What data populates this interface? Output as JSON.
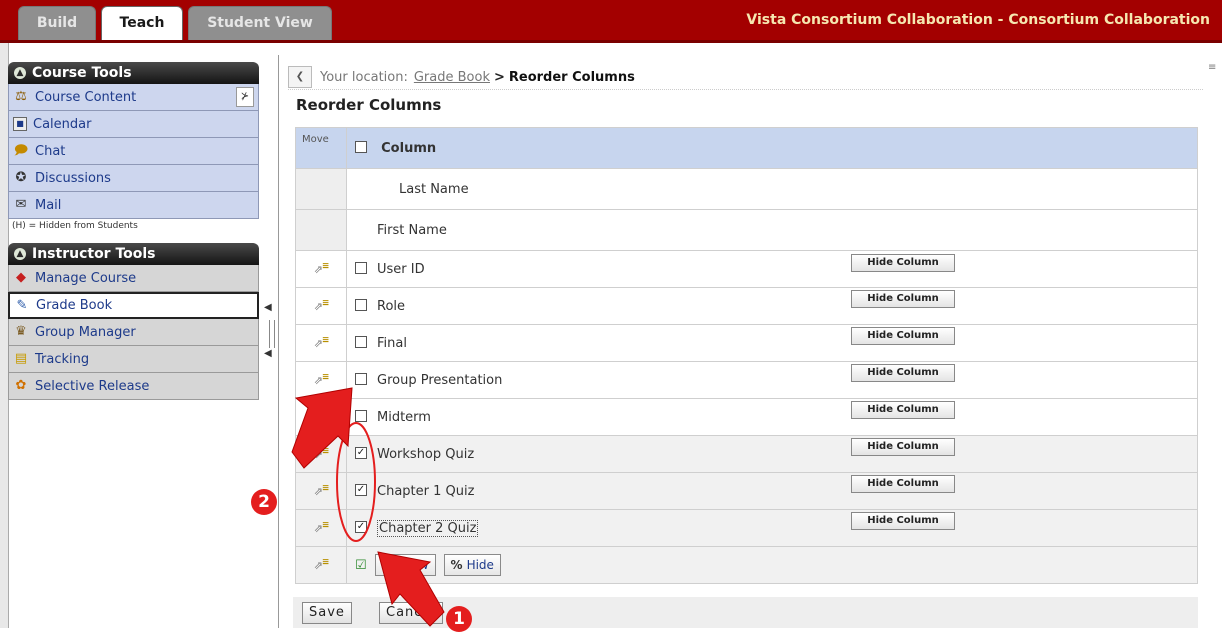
{
  "tabs": [
    {
      "label": "Build",
      "active": false
    },
    {
      "label": "Teach",
      "active": true
    },
    {
      "label": "Student View",
      "active": false
    }
  ],
  "site_title": "Vista Consortium Collaboration - Consortium Collaboration",
  "course_tools": {
    "title": "Course Tools",
    "items": [
      {
        "label": "Course Content",
        "icon": "course-content-icon"
      },
      {
        "label": "Calendar",
        "icon": "calendar-icon"
      },
      {
        "label": "Chat",
        "icon": "chat-icon"
      },
      {
        "label": "Discussions",
        "icon": "discussions-icon"
      },
      {
        "label": "Mail",
        "icon": "mail-icon"
      }
    ],
    "note": "(H) = Hidden from Students"
  },
  "instructor_tools": {
    "title": "Instructor Tools",
    "items": [
      {
        "label": "Manage Course",
        "icon": "manage-course-icon"
      },
      {
        "label": "Grade Book",
        "icon": "grade-book-icon",
        "selected": true
      },
      {
        "label": "Group Manager",
        "icon": "group-manager-icon"
      },
      {
        "label": "Tracking",
        "icon": "tracking-icon"
      },
      {
        "label": "Selective Release",
        "icon": "selective-release-icon"
      }
    ]
  },
  "breadcrumb": {
    "label": "Your location:",
    "link": "Grade Book",
    "separator": ">",
    "current": "Reorder Columns"
  },
  "page_title": "Reorder Columns",
  "table": {
    "move_header": "Move",
    "column_header": "Column",
    "fixed_rows": [
      "Last Name",
      "First Name"
    ],
    "rows": [
      {
        "name": "User ID",
        "checked": false,
        "button": "Hide Column"
      },
      {
        "name": "Role",
        "checked": false,
        "button": "Hide Column"
      },
      {
        "name": "Final",
        "checked": false,
        "button": "Hide Column"
      },
      {
        "name": "Group Presentation",
        "checked": false,
        "button": "Hide Column"
      },
      {
        "name": "Midterm",
        "checked": false,
        "button": "Hide Column"
      },
      {
        "name": "Workshop Quiz",
        "checked": true,
        "button": "Hide Column"
      },
      {
        "name": "Chapter 1 Quiz",
        "checked": true,
        "button": "Hide Column"
      },
      {
        "name": "Chapter 2 Quiz",
        "checked": true,
        "button": "Hide Column"
      }
    ],
    "show_label": "Show",
    "hide_label": "Hide"
  },
  "actions": {
    "save": "Save",
    "cancel": "Cancel"
  },
  "annotations": {
    "badge_1": "1",
    "badge_2": "2"
  },
  "colors": {
    "brand_red": "#a30000",
    "header_blue": "#c7d5ee",
    "annotation_red": "#e41e1e"
  }
}
